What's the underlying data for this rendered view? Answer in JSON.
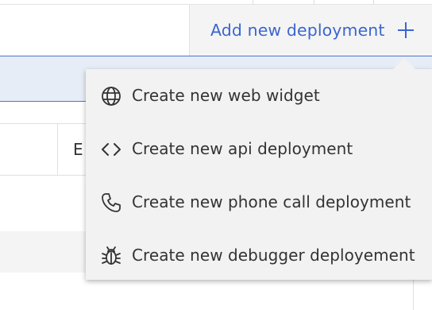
{
  "toolbar": {
    "add_button_label": "Add new deployment",
    "add_button_icon": "plus-icon",
    "accent_color": "#3b66cf"
  },
  "table": {
    "partial_cell_text": "E"
  },
  "menu": {
    "items": [
      {
        "label": "Create new web widget",
        "icon": "globe-icon"
      },
      {
        "label": "Create new api deployment",
        "icon": "code-icon"
      },
      {
        "label": "Create new phone call deployment",
        "icon": "phone-icon"
      },
      {
        "label": "Create new debugger deployement",
        "icon": "bug-icon"
      }
    ]
  }
}
